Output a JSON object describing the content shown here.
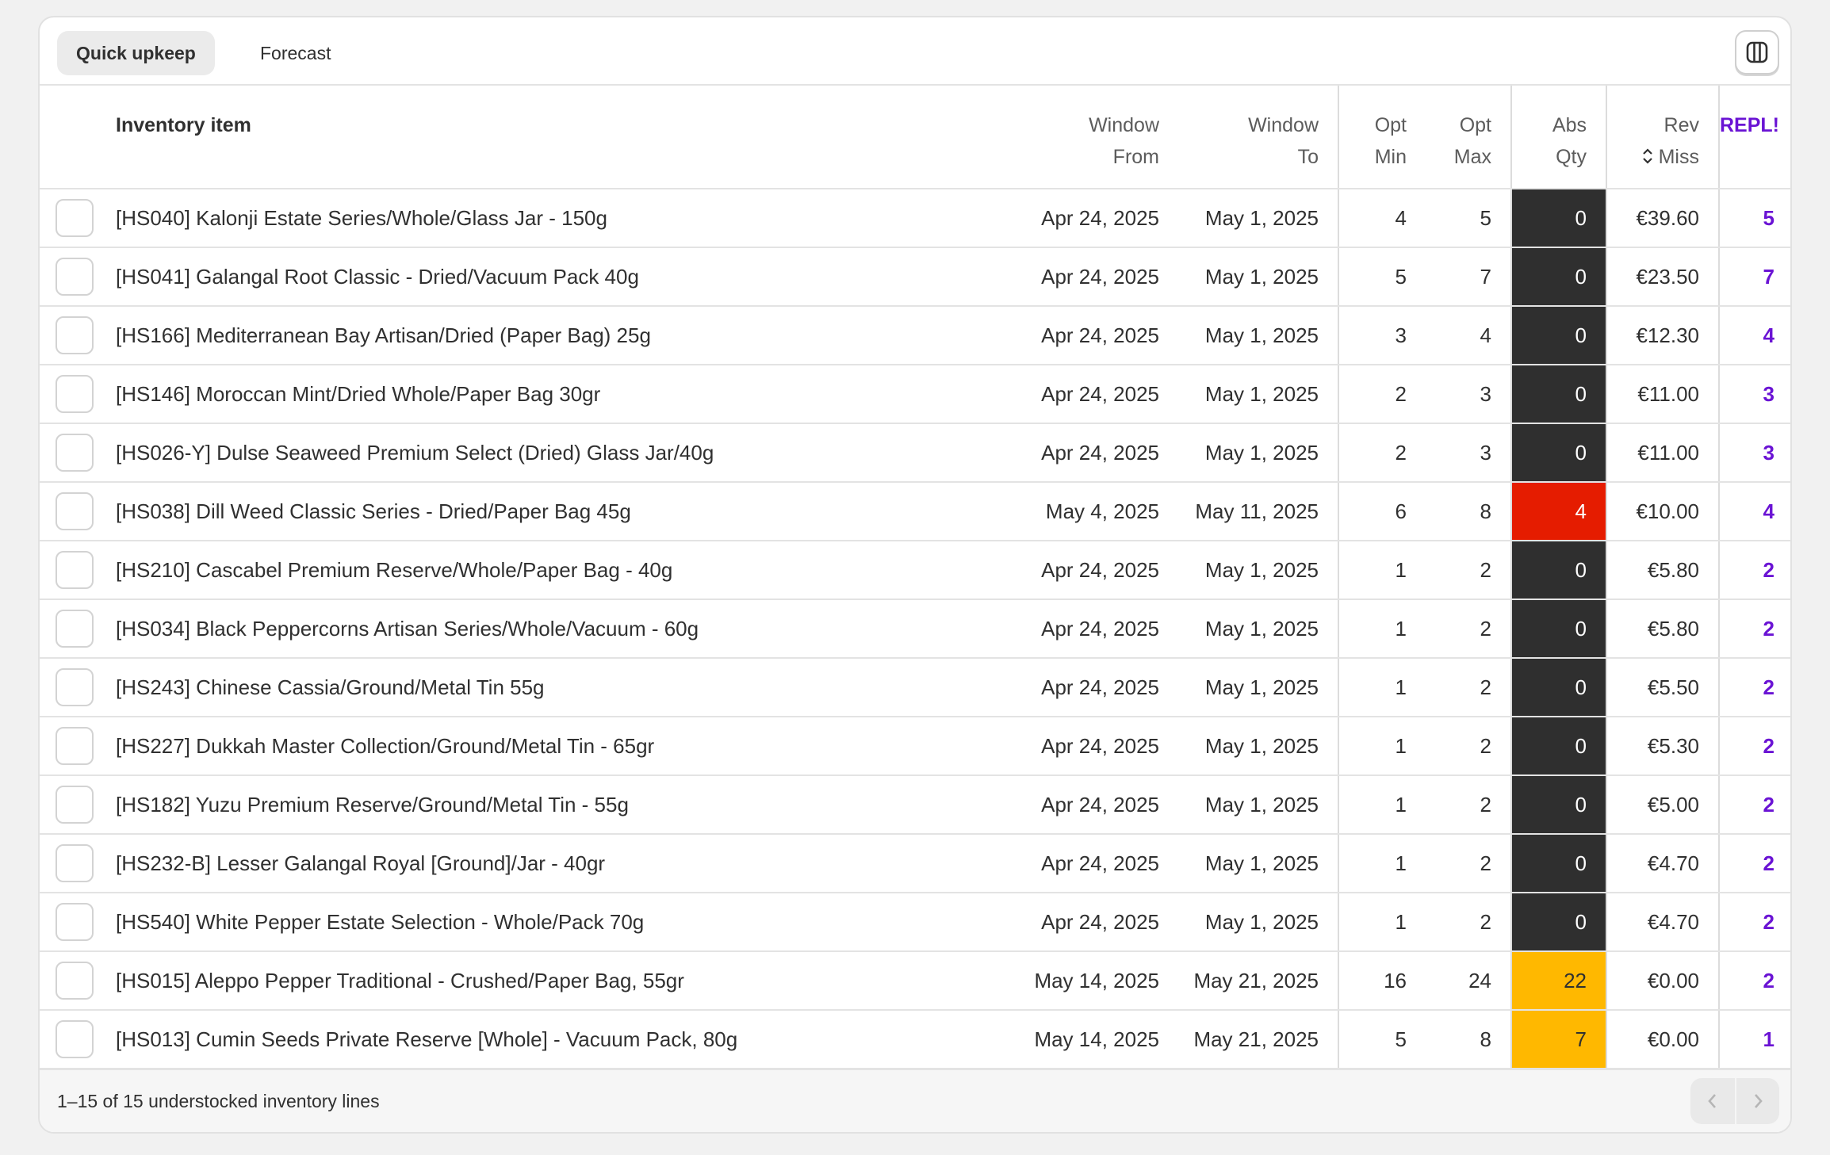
{
  "tabs": [
    {
      "label": "Quick upkeep",
      "active": true
    },
    {
      "label": "Forecast",
      "active": false
    }
  ],
  "toolbar": {
    "columns_icon": "columns-icon"
  },
  "table": {
    "headers": {
      "item": "Inventory item",
      "window_from_1": "Window",
      "window_from_2": "From",
      "window_to_1": "Window",
      "window_to_2": "To",
      "opt_min_1": "Opt",
      "opt_min_2": "Min",
      "opt_max_1": "Opt",
      "opt_max_2": "Max",
      "abs_qty_1": "Abs",
      "abs_qty_2": "Qty",
      "rev_miss_1": "Rev",
      "rev_miss_2": "Miss",
      "repl": "REPL!"
    },
    "rows": [
      {
        "item": "[HS040] Kalonji Estate Series/Whole/Glass Jar - 150g",
        "from": "Apr 24, 2025",
        "to": "May 1, 2025",
        "min": "4",
        "max": "5",
        "abs": "0",
        "abs_status": "dark",
        "rev": "€39.60",
        "repl": "5"
      },
      {
        "item": "[HS041] Galangal Root Classic - Dried/Vacuum Pack 40g",
        "from": "Apr 24, 2025",
        "to": "May 1, 2025",
        "min": "5",
        "max": "7",
        "abs": "0",
        "abs_status": "dark",
        "rev": "€23.50",
        "repl": "7"
      },
      {
        "item": "[HS166] Mediterranean Bay Artisan/Dried (Paper Bag) 25g",
        "from": "Apr 24, 2025",
        "to": "May 1, 2025",
        "min": "3",
        "max": "4",
        "abs": "0",
        "abs_status": "dark",
        "rev": "€12.30",
        "repl": "4"
      },
      {
        "item": "[HS146] Moroccan Mint/Dried Whole/Paper Bag 30gr",
        "from": "Apr 24, 2025",
        "to": "May 1, 2025",
        "min": "2",
        "max": "3",
        "abs": "0",
        "abs_status": "dark",
        "rev": "€11.00",
        "repl": "3"
      },
      {
        "item": "[HS026-Y] Dulse Seaweed Premium Select (Dried) Glass Jar/40g",
        "from": "Apr 24, 2025",
        "to": "May 1, 2025",
        "min": "2",
        "max": "3",
        "abs": "0",
        "abs_status": "dark",
        "rev": "€11.00",
        "repl": "3"
      },
      {
        "item": "[HS038] Dill Weed Classic Series - Dried/Paper Bag 45g",
        "from": "May 4, 2025",
        "to": "May 11, 2025",
        "min": "6",
        "max": "8",
        "abs": "4",
        "abs_status": "red",
        "rev": "€10.00",
        "repl": "4"
      },
      {
        "item": "[HS210] Cascabel Premium Reserve/Whole/Paper Bag - 40g",
        "from": "Apr 24, 2025",
        "to": "May 1, 2025",
        "min": "1",
        "max": "2",
        "abs": "0",
        "abs_status": "dark",
        "rev": "€5.80",
        "repl": "2"
      },
      {
        "item": "[HS034] Black Peppercorns Artisan Series/Whole/Vacuum - 60g",
        "from": "Apr 24, 2025",
        "to": "May 1, 2025",
        "min": "1",
        "max": "2",
        "abs": "0",
        "abs_status": "dark",
        "rev": "€5.80",
        "repl": "2"
      },
      {
        "item": "[HS243] Chinese Cassia/Ground/Metal Tin 55g",
        "from": "Apr 24, 2025",
        "to": "May 1, 2025",
        "min": "1",
        "max": "2",
        "abs": "0",
        "abs_status": "dark",
        "rev": "€5.50",
        "repl": "2"
      },
      {
        "item": "[HS227] Dukkah Master Collection/Ground/Metal Tin - 65gr",
        "from": "Apr 24, 2025",
        "to": "May 1, 2025",
        "min": "1",
        "max": "2",
        "abs": "0",
        "abs_status": "dark",
        "rev": "€5.30",
        "repl": "2"
      },
      {
        "item": "[HS182] Yuzu Premium Reserve/Ground/Metal Tin - 55g",
        "from": "Apr 24, 2025",
        "to": "May 1, 2025",
        "min": "1",
        "max": "2",
        "abs": "0",
        "abs_status": "dark",
        "rev": "€5.00",
        "repl": "2"
      },
      {
        "item": "[HS232-B] Lesser Galangal Royal [Ground]/Jar - 40gr",
        "from": "Apr 24, 2025",
        "to": "May 1, 2025",
        "min": "1",
        "max": "2",
        "abs": "0",
        "abs_status": "dark",
        "rev": "€4.70",
        "repl": "2"
      },
      {
        "item": "[HS540] White Pepper Estate Selection - Whole/Pack 70g",
        "from": "Apr 24, 2025",
        "to": "May 1, 2025",
        "min": "1",
        "max": "2",
        "abs": "0",
        "abs_status": "dark",
        "rev": "€4.70",
        "repl": "2"
      },
      {
        "item": "[HS015] Aleppo Pepper Traditional - Crushed/Paper Bag, 55gr",
        "from": "May 14, 2025",
        "to": "May 21, 2025",
        "min": "16",
        "max": "24",
        "abs": "22",
        "abs_status": "amber",
        "rev": "€0.00",
        "repl": "2"
      },
      {
        "item": "[HS013] Cumin Seeds Private Reserve [Whole] - Vacuum Pack, 80g",
        "from": "May 14, 2025",
        "to": "May 21, 2025",
        "min": "5",
        "max": "8",
        "abs": "7",
        "abs_status": "amber",
        "rev": "€0.00",
        "repl": "1"
      }
    ]
  },
  "footer": {
    "summary": "1–15 of 15 understocked inventory lines",
    "prev_icon": "chevron-left-icon",
    "next_icon": "chevron-right-icon"
  },
  "colors": {
    "accent": "#6a13d4",
    "abs_dark": "#2f2f2f",
    "abs_red": "#e51c00",
    "abs_amber": "#ffb800"
  }
}
